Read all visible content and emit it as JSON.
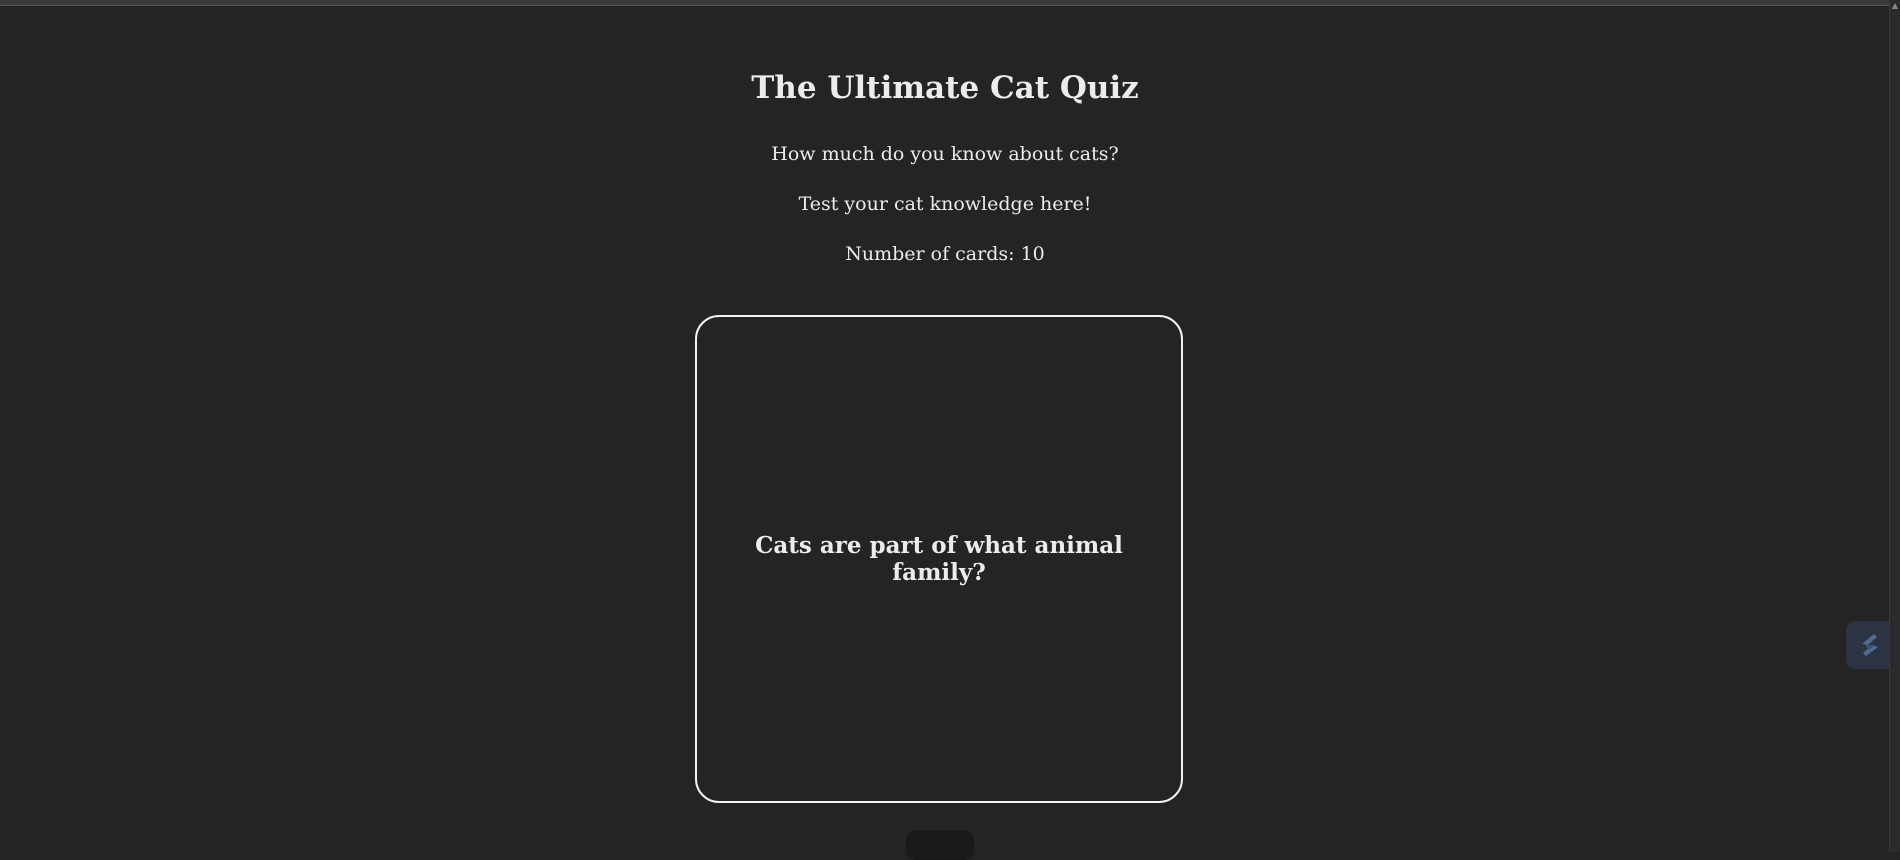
{
  "header": {
    "title": "The Ultimate Cat Quiz",
    "subtitle": "How much do you know about cats?",
    "tagline": "Test your cat knowledge here!",
    "card_count_text": "Number of cards: 10"
  },
  "card": {
    "question": "Cats are part of what animal family?"
  },
  "icons": {
    "side_widget": "lightning-extension-icon",
    "scroll_up": "scroll-up-arrow-icon"
  },
  "colors": {
    "background": "#242424",
    "text": "#ececec",
    "card_border": "#f2f2f2",
    "widget_bg": "#2c3444"
  }
}
